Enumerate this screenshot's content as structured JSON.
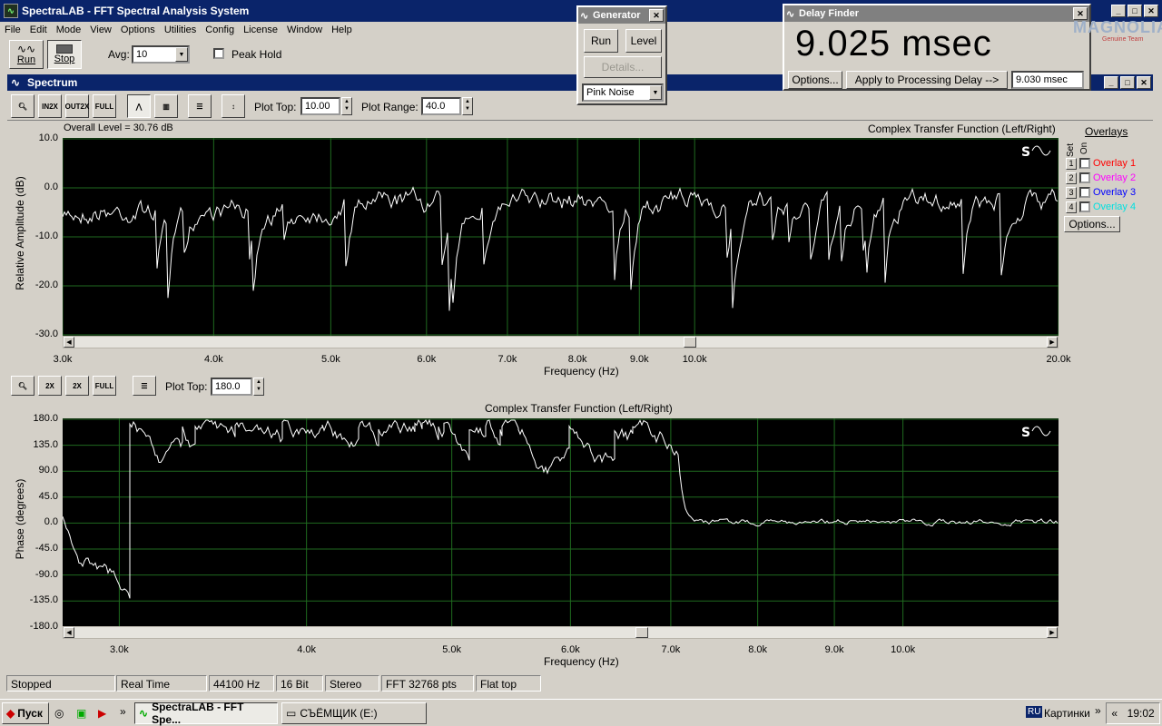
{
  "window": {
    "title": "SpectraLAB - FFT Spectral Analysis System"
  },
  "menu": [
    "File",
    "Edit",
    "Mode",
    "View",
    "Options",
    "Utilities",
    "Config",
    "License",
    "Window",
    "Help"
  ],
  "toolbar": {
    "run_label": "Run",
    "stop_label": "Stop",
    "avg_label": "Avg:",
    "avg_value": "10",
    "peak_hold_label": "Peak Hold"
  },
  "generator": {
    "title": "Generator",
    "run_label": "Run",
    "level_label": "Level",
    "details_label": "Details...",
    "signal": "Pink Noise"
  },
  "delay_finder": {
    "title": "Delay Finder",
    "value": "9.025 msec",
    "options_label": "Options...",
    "apply_label": "Apply to Processing Delay -->",
    "delay_value": "9.030 msec",
    "brand": "MAGNOLIA",
    "brand_sub": "Genuine Team"
  },
  "spectrum": {
    "title": "Spectrum",
    "plot_top_label": "Plot Top:",
    "plot_top_value": "10.00",
    "plot_range_label": "Plot Range:",
    "plot_range_value": "40.0",
    "overall_level": "Overall Level = 30.76 dB",
    "plot_title": "Complex Transfer Function (Left/Right)",
    "ylabel": "Relative Amplitude (dB)",
    "xlabel": "Frequency (Hz)",
    "yticks": [
      "10.0",
      "0.0",
      "-10.0",
      "-20.0",
      "-30.0"
    ],
    "xticks": [
      "3.0k",
      "4.0k",
      "5.0k",
      "6.0k",
      "7.0k",
      "8.0k",
      "9.0k",
      "10.0k",
      "20.0k"
    ]
  },
  "overlays": {
    "title": "Overlays",
    "set_label": "Set",
    "on_label": "On",
    "items": [
      {
        "num": "1",
        "label": "Overlay 1",
        "color": "#ff0000"
      },
      {
        "num": "2",
        "label": "Overlay 2",
        "color": "#ff00ff"
      },
      {
        "num": "3",
        "label": "Overlay 3",
        "color": "#0000ff"
      },
      {
        "num": "4",
        "label": "Overlay 4",
        "color": "#00e0e0"
      }
    ],
    "options_label": "Options..."
  },
  "phase": {
    "plot_top_label": "Plot Top:",
    "plot_top_value": "180.0",
    "plot_title": "Complex Transfer Function (Left/Right)",
    "ylabel": "Phase (degrees)",
    "xlabel": "Frequency (Hz)",
    "yticks": [
      "180.0",
      "135.0",
      "90.0",
      "45.0",
      "0.0",
      "-45.0",
      "-90.0",
      "-135.0",
      "-180.0"
    ],
    "xticks": [
      "3.0k",
      "4.0k",
      "5.0k",
      "6.0k",
      "7.0k",
      "8.0k",
      "9.0k",
      "10.0k"
    ]
  },
  "status": [
    "Stopped",
    "Real Time",
    "44100 Hz",
    "16 Bit",
    "Stereo",
    "FFT 32768 pts",
    "Flat top"
  ],
  "taskbar": {
    "start_label": "Пуск",
    "tasks": [
      "SpectraLAB - FFT Spe...",
      "СЪЁМЩИК (E:)"
    ],
    "lang": "RU",
    "tray_label": "Картинки",
    "clock": "19:02"
  },
  "colors": {
    "plot_bg": "#000000",
    "grid": "#1f6a1f",
    "trace": "#ffffff",
    "title_active": "#0a246a"
  }
}
